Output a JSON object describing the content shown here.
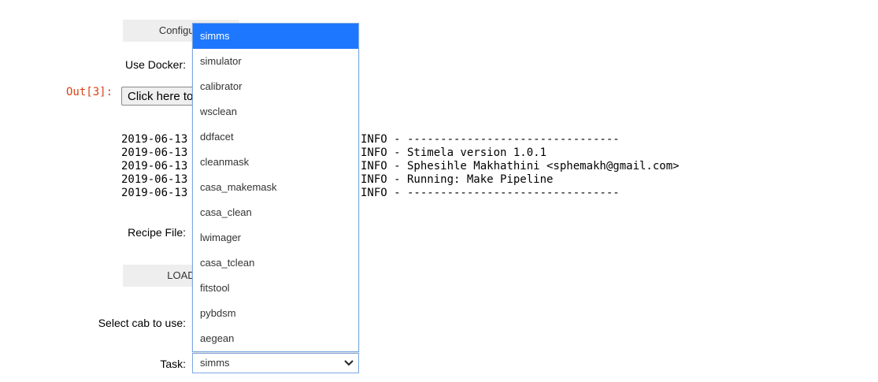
{
  "configure_button": {
    "label": "Configure"
  },
  "use_docker": {
    "label": "Use Docker:"
  },
  "output": {
    "prompt": "Out[3]:",
    "click_button_label": "Click here to"
  },
  "log_lines": [
    {
      "date": "2019-06-13",
      "message": "INFO - --------------------------------"
    },
    {
      "date": "2019-06-13",
      "message": "INFO - Stimela version 1.0.1"
    },
    {
      "date": "2019-06-13",
      "message": "INFO - Sphesihle Makhathini <sphemakh@gmail.com>"
    },
    {
      "date": "2019-06-13",
      "message": "INFO - Running: Make Pipeline"
    },
    {
      "date": "2019-06-13",
      "message": "INFO - --------------------------------"
    }
  ],
  "recipe_file": {
    "label": "Recipe File:"
  },
  "load_button": {
    "label": "LOAD"
  },
  "select_cab": {
    "label": "Select cab to use:"
  },
  "task": {
    "label": "Task:",
    "selected": "simms",
    "options": [
      "simms",
      "simulator",
      "calibrator",
      "wsclean",
      "ddfacet",
      "cleanmask",
      "casa_makemask",
      "casa_clean",
      "lwimager",
      "casa_tclean",
      "fitstool",
      "pybdsm",
      "aegean"
    ]
  },
  "colors": {
    "selected_option_bg": "#1e78ff",
    "prompt_color": "#d84315",
    "button_bg": "#eeeeee",
    "dropdown_border": "#7aa7e0"
  }
}
